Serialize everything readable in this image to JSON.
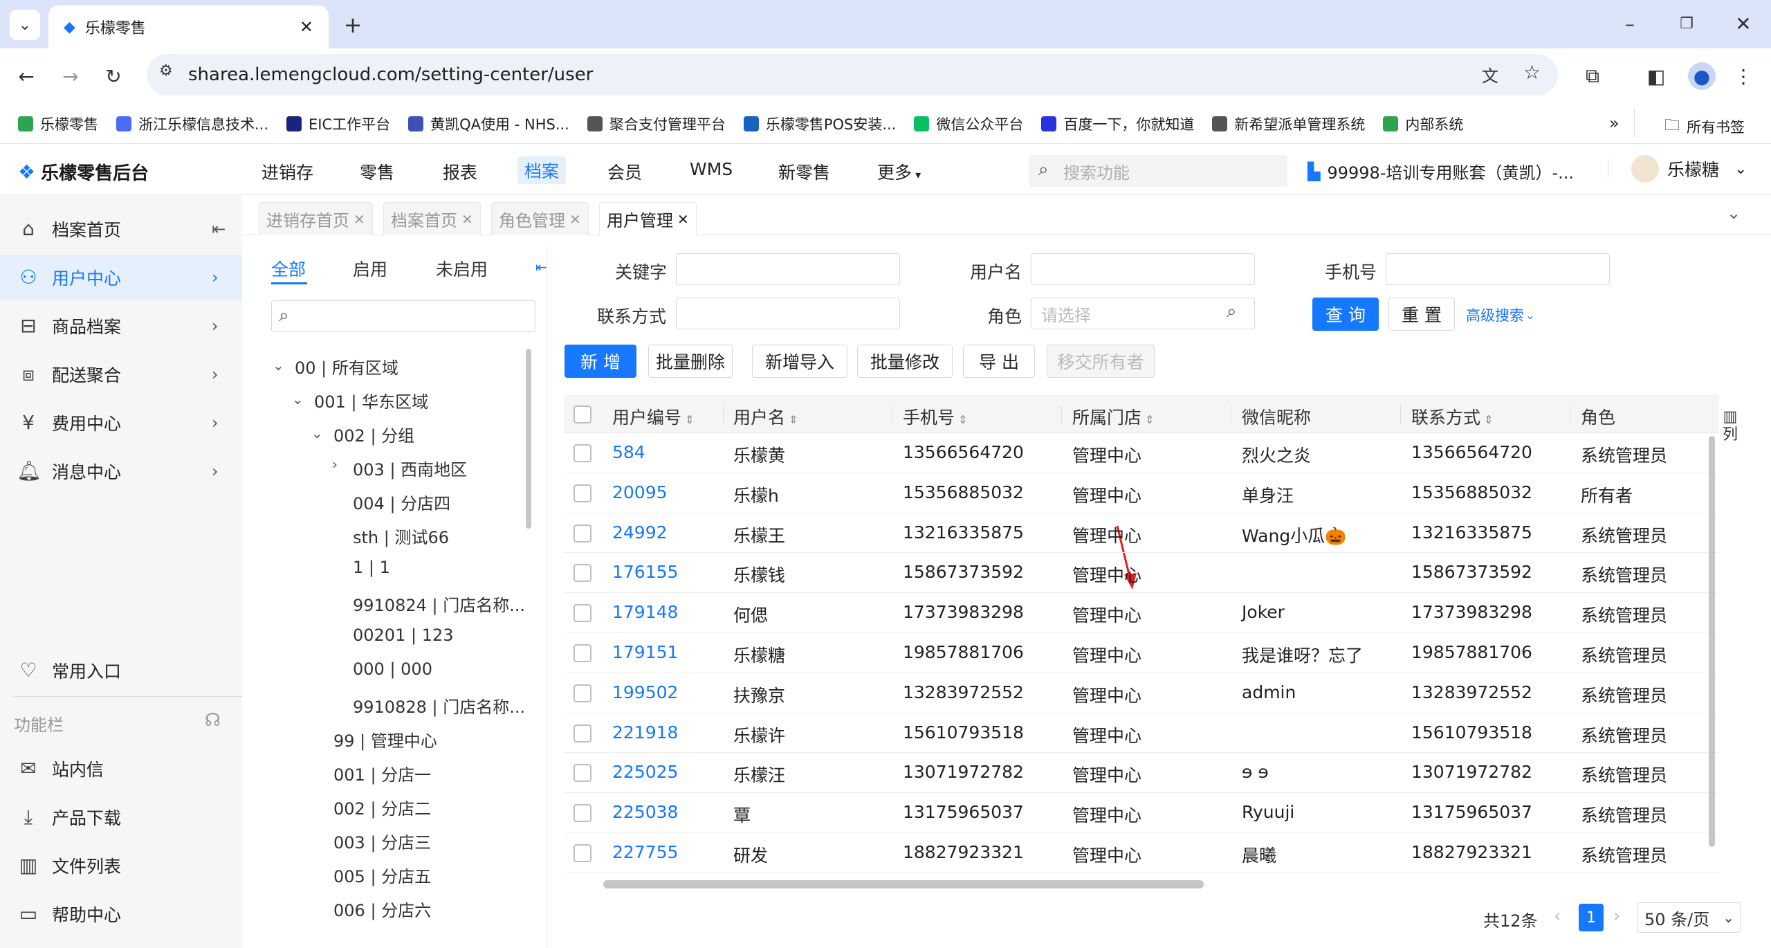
{
  "browser": {
    "tab_title": "乐檬零售",
    "url": "sharea.lemengcloud.com/setting-center/user"
  },
  "bookmarks": [
    {
      "label": "乐檬零售",
      "color": "#2ea44f"
    },
    {
      "label": "浙江乐檬信息技术...",
      "color": "#4a6cf7"
    },
    {
      "label": "EIC工作平台",
      "color": "#1a237e"
    },
    {
      "label": "黄凯QA使用 - NHS...",
      "color": "#3f51b5"
    },
    {
      "label": "聚合支付管理平台",
      "color": "#555555"
    },
    {
      "label": "乐檬零售POS安装...",
      "color": "#1565c0"
    },
    {
      "label": "微信公众平台",
      "color": "#07c160"
    },
    {
      "label": "百度一下，你就知道",
      "color": "#2932e1"
    },
    {
      "label": "新希望派单管理系统",
      "color": "#555555"
    },
    {
      "label": "内部系统",
      "color": "#2ea44f"
    }
  ],
  "bookmarks_right": "所有书签",
  "app": {
    "logo": "乐檬零售后台",
    "account": "99998-培训专用账套（黄凯）-...",
    "user": "乐檬糖",
    "search_placeholder": "搜索功能"
  },
  "nav": [
    "进销存",
    "零售",
    "报表",
    "档案",
    "会员",
    "WMS",
    "新零售",
    "更多"
  ],
  "sidebar": {
    "menus": [
      "档案首页",
      "用户中心",
      "商品档案",
      "配送聚合",
      "费用中心",
      "消息中心"
    ],
    "common": "常用入口",
    "func_label": "功能栏",
    "tools": [
      "站内信",
      "产品下载",
      "文件列表",
      "帮助中心"
    ]
  },
  "page_tabs": [
    "进销存首页",
    "档案首页",
    "角色管理",
    "用户管理"
  ],
  "tree": {
    "tabs": [
      "全部",
      "启用",
      "未启用"
    ],
    "nodes": [
      "00 | 所有区域",
      "001 | 华东区域",
      "002 | 分组",
      "003 | 西南地区",
      "004 | 分店四",
      "sth | 测试66",
      "1 | 1",
      "9910824 | 门店名称...",
      "00201 | 123",
      "000 | 000",
      "9910828 | 门店名称...",
      "99 | 管理中心",
      "001 | 分店一",
      "002 | 分店二",
      "003 | 分店三",
      "005 | 分店五",
      "006 | 分店六"
    ]
  },
  "filters": {
    "keyword": "关键字",
    "username": "用户名",
    "phone": "手机号",
    "contact": "联系方式",
    "role": "角色",
    "role_placeholder": "请选择",
    "query": "查 询",
    "reset": "重 置",
    "advanced": "高级搜索"
  },
  "actions": [
    "新 增",
    "批量删除",
    "新增导入",
    "批量修改",
    "导 出",
    "移交所有者"
  ],
  "table": {
    "headers": [
      "用户编号",
      "用户名",
      "手机号",
      "所属门店",
      "微信昵称",
      "联系方式",
      "角色"
    ],
    "col_label": "列",
    "rows": [
      [
        "584",
        "乐檬黄",
        "13566564720",
        "管理中心",
        "烈火之炎",
        "13566564720",
        "系统管理员"
      ],
      [
        "20095",
        "乐檬h",
        "15356885032",
        "管理中心",
        "单身汪",
        "15356885032",
        "所有者"
      ],
      [
        "24992",
        "乐檬王",
        "13216335875",
        "管理中心",
        "Wang小瓜🎃",
        "13216335875",
        "系统管理员"
      ],
      [
        "176155",
        "乐檬钱",
        "15867373592",
        "管理中心",
        "",
        "15867373592",
        "系统管理员"
      ],
      [
        "179148",
        "何偲",
        "17373983298",
        "管理中心",
        "Joker",
        "17373983298",
        "系统管理员"
      ],
      [
        "179151",
        "乐檬糖",
        "19857881706",
        "管理中心",
        "我是谁呀？忘了",
        "19857881706",
        "系统管理员"
      ],
      [
        "199502",
        "扶豫京",
        "13283972552",
        "管理中心",
        "admin",
        "13283972552",
        "系统管理员"
      ],
      [
        "221918",
        "乐檬许",
        "15610793518",
        "管理中心",
        "",
        "15610793518",
        "系统管理员"
      ],
      [
        "225025",
        "乐檬汪",
        "13071972782",
        "管理中心",
        "ɘ ɘ",
        "13071972782",
        "系统管理员"
      ],
      [
        "225038",
        "覃",
        "13175965037",
        "管理中心",
        "Ryuuji",
        "13175965037",
        "系统管理员"
      ],
      [
        "227755",
        "研发",
        "18827923321",
        "管理中心",
        "晨曦",
        "18827923321",
        "系统管理员"
      ]
    ]
  },
  "pagination": {
    "total": "共12条",
    "page": "1",
    "size": "50 条/页"
  }
}
